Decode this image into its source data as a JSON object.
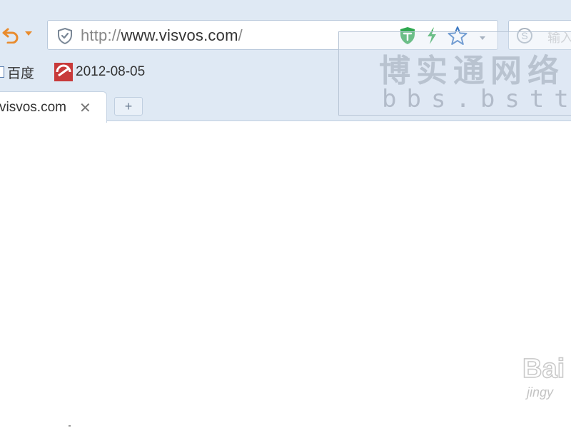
{
  "toolbar": {
    "back_icon": "undo-arrow-icon",
    "back_dropdown_icon": "dropdown-caret-icon",
    "address": {
      "url_prefix": "http://",
      "url_host": "www.visvos.com",
      "url_suffix": "/",
      "shield_icon": "shield-check-icon",
      "safe_icon": "safe-shield-icon",
      "bolt_icon": "lightning-icon",
      "star_icon": "star-icon",
      "dropdown_icon": "chevron-down-icon"
    },
    "search": {
      "logo_icon": "search-engine-s-icon",
      "placeholder": "输入"
    }
  },
  "bookmarks": [
    {
      "label": "百度",
      "icon": "page-icon"
    },
    {
      "label": "2012-08-05",
      "icon": "favicon-icon"
    }
  ],
  "tabs": [
    {
      "title": "visvos.com",
      "close_icon": "close-icon"
    }
  ],
  "new_tab_label": "+",
  "watermarks": {
    "panel_cn": "博实通网络",
    "panel_en": "bbs.bstto",
    "corner_main": "Bai",
    "corner_sub": "jingy"
  },
  "colors": {
    "chrome_bg": "#dfe9f4",
    "accent_orange": "#e98b2c",
    "safe_green": "#2fa84f",
    "star_blue": "#3c78c2"
  }
}
